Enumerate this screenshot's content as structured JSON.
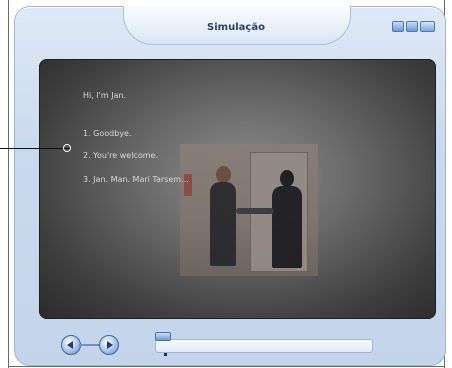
{
  "window": {
    "title": "Simulação"
  },
  "simulation": {
    "greeting": "Hi, I'm Jan.",
    "options": [
      "1. Goodbye.",
      "2. You're welcome.",
      "3. Jan. Man. Mari Tarsem..."
    ]
  },
  "controls": {
    "progress_fraction": 0.05
  },
  "icons": {
    "prev": "previous-icon",
    "next": "next-icon"
  },
  "colors": {
    "accent": "#6f98d3",
    "frame": "#c9d9ee"
  }
}
